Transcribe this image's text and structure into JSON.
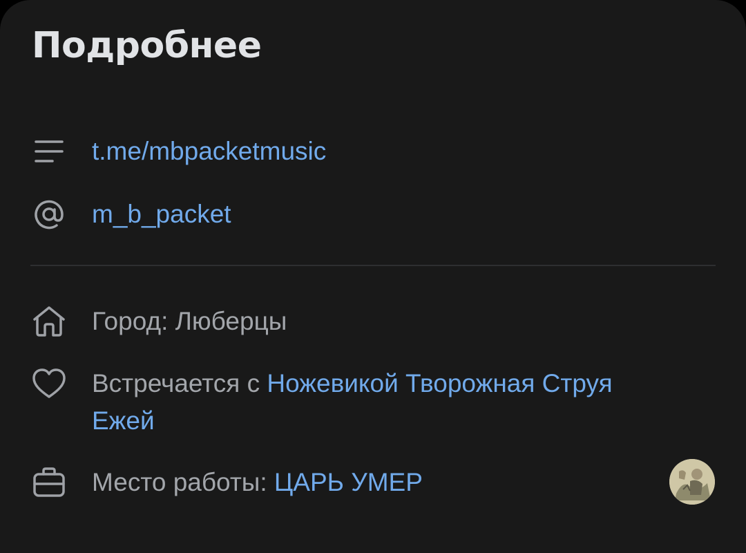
{
  "details": {
    "title": "Подробнее",
    "telegram_link": "t.me/mbpacketmusic",
    "username": "m_b_packet",
    "city_label": "Город: Люберцы",
    "relationship_prefix": "Встречается с ",
    "relationship_name_line1": "Ножевикой Творожная Струя",
    "relationship_name_line2": "Ежей",
    "work_label": "Место работы: ",
    "work_name": "ЦАРЬ УМЕР"
  },
  "colors": {
    "background": "#191919",
    "title": "#e1e3e6",
    "secondary_text": "#a3a6ab",
    "link": "#71aaeb",
    "icon": "#9fa2a7"
  },
  "icons": {
    "website": "lines-icon",
    "username": "at-sign-icon",
    "city": "home-icon",
    "relationship": "heart-icon",
    "work": "briefcase-icon"
  }
}
